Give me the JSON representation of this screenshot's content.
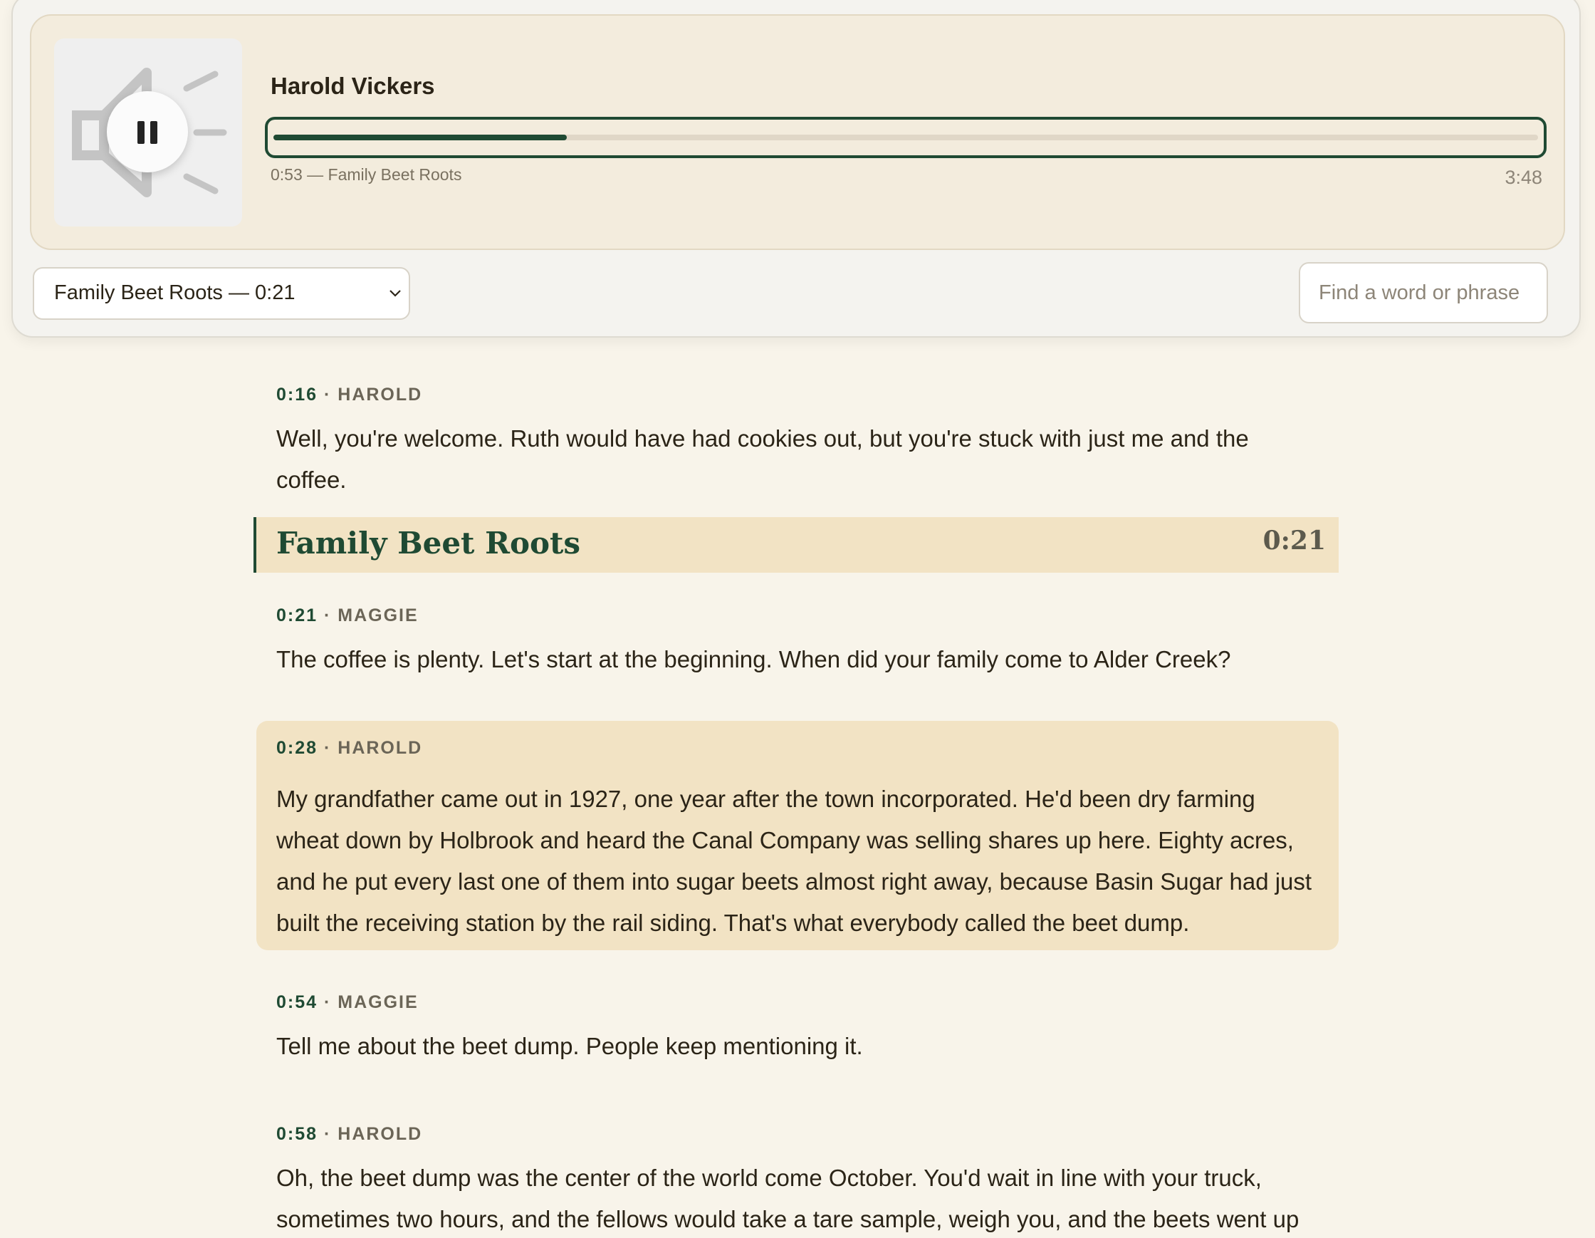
{
  "player": {
    "speaker_name": "Harold Vickers",
    "elapsed_label": "0:53 — Family Beet Roots",
    "duration": "3:48",
    "progress_fraction": 0.232,
    "state": "playing",
    "artwork_icon": "speaker-icon",
    "pause_icon": "pause-icon"
  },
  "controls": {
    "chapter_select_value": "Family Beet Roots — 0:21",
    "search_placeholder": "Find a word or phrase"
  },
  "transcript": {
    "entries": [
      {
        "timestamp": "0:16",
        "speaker": "HAROLD",
        "text": "Well, you're welcome. Ruth would have had cookies out, but you're stuck with just me and the coffee."
      },
      {
        "timestamp": "0:21",
        "speaker": "MAGGIE",
        "text": "The coffee is plenty. Let's start at the beginning. When did your family come to Alder Creek?"
      },
      {
        "timestamp": "0:28",
        "speaker": "HAROLD",
        "text": "My grandfather came out in 1927, one year after the town incorporated. He'd been dry farming wheat down by Holbrook and heard the Canal Company was selling shares up here. Eighty acres, and he put every last one of them into sugar beets almost right away, because Basin Sugar had just built the receiving station by the rail siding. That's what everybody called the beet dump."
      },
      {
        "timestamp": "0:54",
        "speaker": "MAGGIE",
        "text": "Tell me about the beet dump. People keep mentioning it."
      },
      {
        "timestamp": "0:58",
        "speaker": "HAROLD",
        "text": "Oh, the beet dump was the center of the world come October. You'd wait in line with your truck, sometimes two hours, and the fellows would take a tare sample, weigh you, and the beets went up the"
      }
    ],
    "chapter": {
      "title": "Family Beet Roots",
      "time": "0:21"
    },
    "separator": " · "
  },
  "colors": {
    "accent": "#1f4a33",
    "highlight": "#f2e3c4",
    "background": "#f8f4ea"
  }
}
